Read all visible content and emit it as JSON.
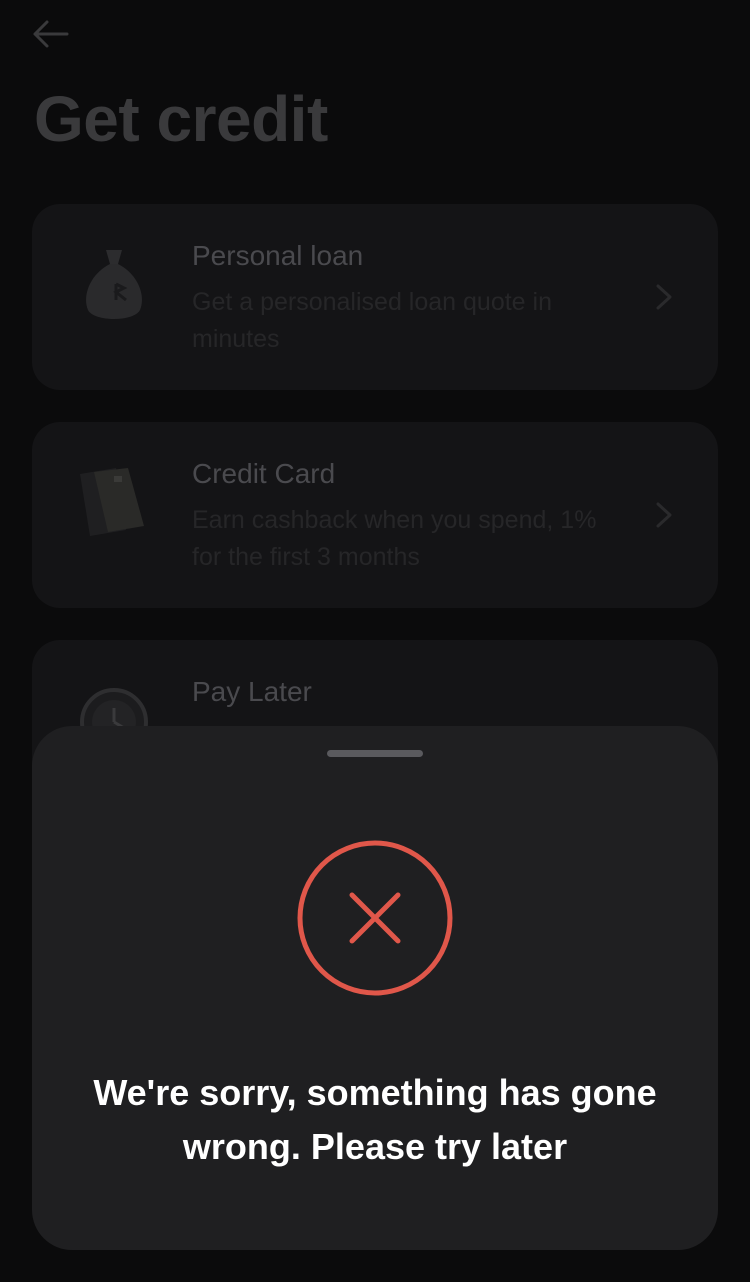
{
  "header": {
    "back_icon": "arrow-left-icon",
    "title": "Get credit"
  },
  "products": [
    {
      "title": "Personal loan",
      "description": "Get a personalised loan quote in minutes",
      "icon": "money-bag-icon"
    },
    {
      "title": "Credit Card",
      "description": "Earn cashback when you spend, 1% for the first 3 months",
      "icon": "credit-card-icon"
    },
    {
      "title": "Pay Later",
      "description": "",
      "icon": "clock-icon"
    }
  ],
  "error_sheet": {
    "icon": "close-circle-icon",
    "message": "We're sorry, something has gone wrong. Please try later"
  },
  "colors": {
    "background": "#0b0b0c",
    "card": "#141416",
    "sheet": "#1f1f21",
    "error_accent": "#e0574a",
    "text_primary": "#ffffff"
  }
}
